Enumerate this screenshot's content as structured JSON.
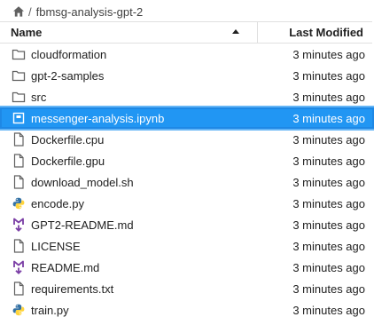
{
  "breadcrumb": {
    "home_icon": "home-icon",
    "separator": "/",
    "path": "fbmsg-analysis-gpt-2"
  },
  "columns": {
    "name": "Name",
    "last_modified": "Last Modified",
    "sort": "ascending"
  },
  "colors": {
    "selected_bg": "#2196f3",
    "folder_icon": "#616161",
    "python_blue": "#3572a5",
    "python_yellow": "#ffd43b",
    "markdown_purple": "#7b3fa6"
  },
  "files": [
    {
      "name": "cloudformation",
      "modified": "3 minutes ago",
      "icon": "folder-icon"
    },
    {
      "name": "gpt-2-samples",
      "modified": "3 minutes ago",
      "icon": "folder-icon"
    },
    {
      "name": "src",
      "modified": "3 minutes ago",
      "icon": "folder-icon"
    },
    {
      "name": "messenger-analysis.ipynb",
      "modified": "3 minutes ago",
      "icon": "notebook-icon",
      "selected": true
    },
    {
      "name": "Dockerfile.cpu",
      "modified": "3 minutes ago",
      "icon": "file-icon"
    },
    {
      "name": "Dockerfile.gpu",
      "modified": "3 minutes ago",
      "icon": "file-icon"
    },
    {
      "name": "download_model.sh",
      "modified": "3 minutes ago",
      "icon": "file-icon"
    },
    {
      "name": "encode.py",
      "modified": "3 minutes ago",
      "icon": "python-icon"
    },
    {
      "name": "GPT2-README.md",
      "modified": "3 minutes ago",
      "icon": "markdown-icon"
    },
    {
      "name": "LICENSE",
      "modified": "3 minutes ago",
      "icon": "file-icon"
    },
    {
      "name": "README.md",
      "modified": "3 minutes ago",
      "icon": "markdown-icon"
    },
    {
      "name": "requirements.txt",
      "modified": "3 minutes ago",
      "icon": "file-icon"
    },
    {
      "name": "train.py",
      "modified": "3 minutes ago",
      "icon": "python-icon"
    }
  ]
}
